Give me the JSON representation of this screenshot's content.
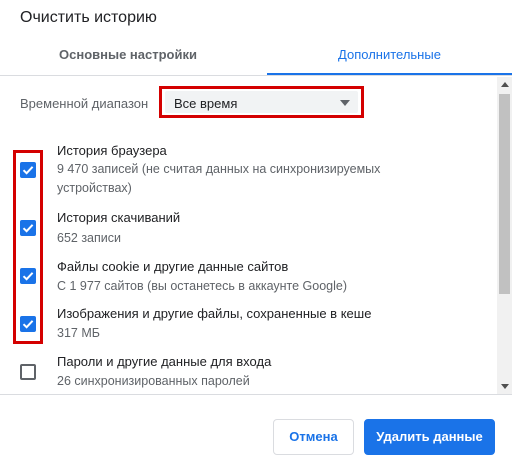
{
  "dialog": {
    "title": "Очистить историю"
  },
  "tabs": [
    {
      "label": "Основные настройки",
      "active": false
    },
    {
      "label": "Дополнительные",
      "active": true
    }
  ],
  "time_range": {
    "label": "Временной диапазон",
    "value": "Все время"
  },
  "items": [
    {
      "title": "История браузера",
      "description": "9 470 записей (не считая данных на синхронизируемых устройствах)",
      "checked": true
    },
    {
      "title": "История скачиваний",
      "description": "652 записи",
      "checked": true
    },
    {
      "title": "Файлы cookie и другие данные сайтов",
      "description": "С 1 977 сайтов (вы останетесь в аккаунте Google)",
      "checked": true
    },
    {
      "title": "Изображения и другие файлы, сохраненные в кеше",
      "description": "317 МБ",
      "checked": true
    },
    {
      "title": "Пароли и другие данные для входа",
      "description": "26 синхронизированных паролей",
      "checked": false
    }
  ],
  "buttons": {
    "cancel": "Отмена",
    "delete": "Удалить данные"
  },
  "colors": {
    "accent": "#1a73e8",
    "highlight": "#d40000"
  },
  "icons": {
    "checkbox_checked": "check-icon",
    "dropdown": "caret-down-icon"
  }
}
